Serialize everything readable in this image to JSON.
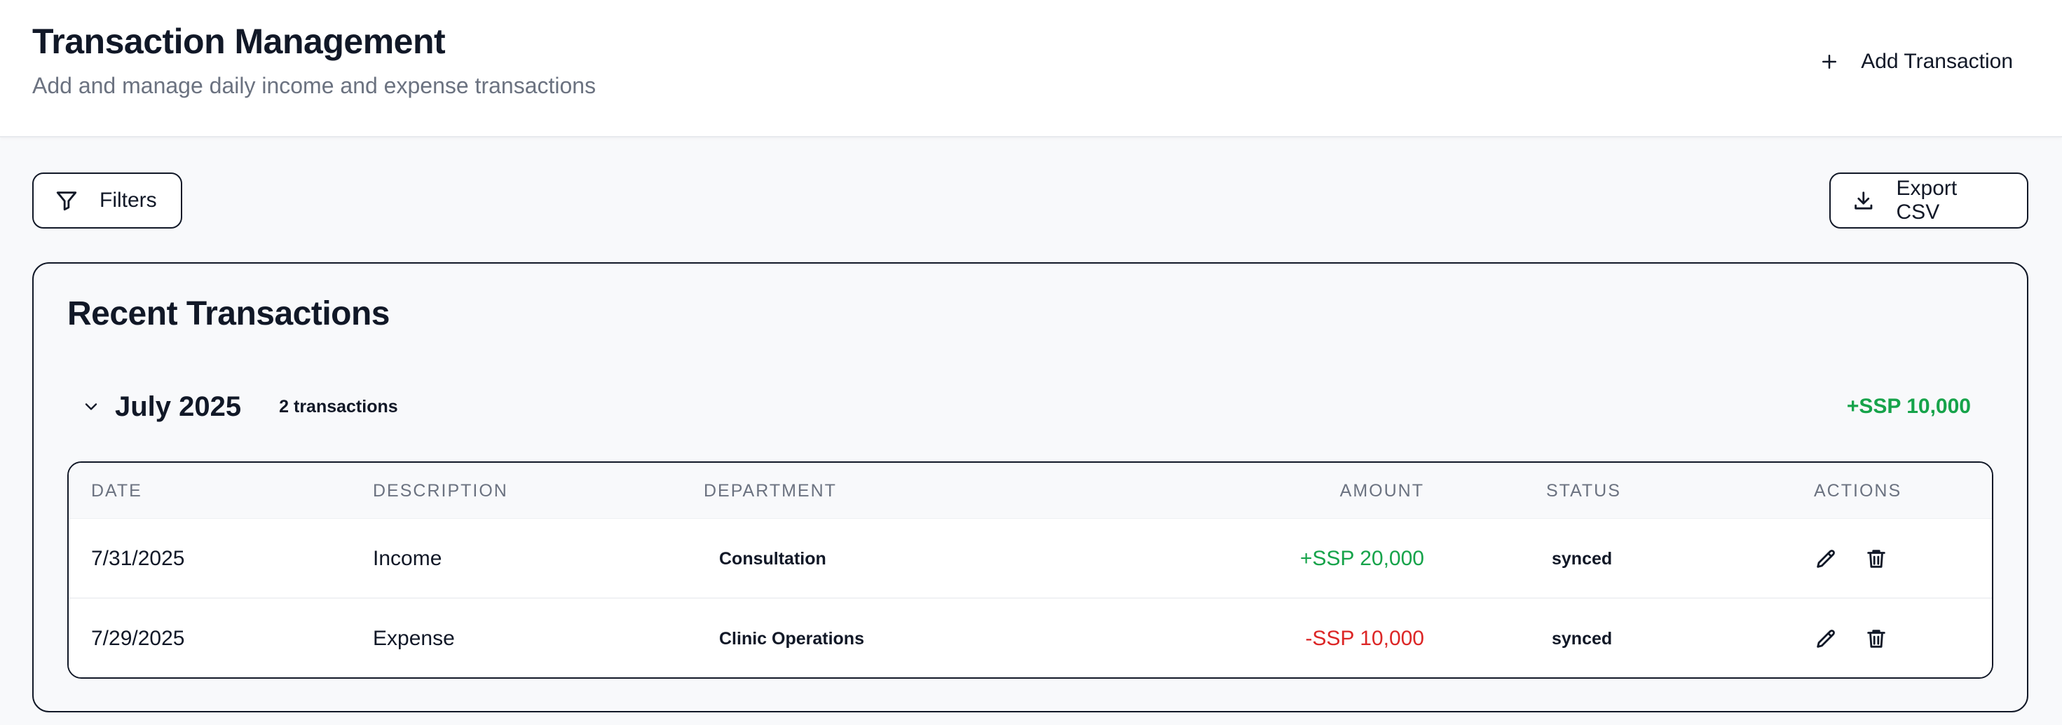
{
  "header": {
    "title": "Transaction Management",
    "subtitle": "Add and manage daily income and expense transactions",
    "add_button_label": "Add Transaction"
  },
  "toolbar": {
    "filters_label": "Filters",
    "export_label": "Export CSV"
  },
  "card": {
    "title": "Recent Transactions",
    "group": {
      "month": "July 2025",
      "count": "2 transactions",
      "total": "+SSP 10,000"
    }
  },
  "table": {
    "headers": {
      "date": "DATE",
      "description": "DESCRIPTION",
      "department": "DEPARTMENT",
      "amount": "AMOUNT",
      "status": "STATUS",
      "actions": "ACTIONS"
    },
    "rows": [
      {
        "date": "7/31/2025",
        "description": "Income",
        "department": "Consultation",
        "amount": "+SSP 20,000",
        "status": "synced"
      },
      {
        "date": "7/29/2025",
        "description": "Expense",
        "department": "Clinic Operations",
        "amount": "-SSP 10,000",
        "status": "synced"
      }
    ]
  },
  "colors": {
    "income": "#16a34a",
    "expense": "#dc2626",
    "text": "#111827",
    "muted": "#6b7280"
  },
  "icons": {
    "add": "plus-icon",
    "filters": "filter-icon",
    "export": "download-icon",
    "group_toggle": "chevron-down-icon",
    "edit": "pencil-icon",
    "delete": "trash-icon"
  }
}
